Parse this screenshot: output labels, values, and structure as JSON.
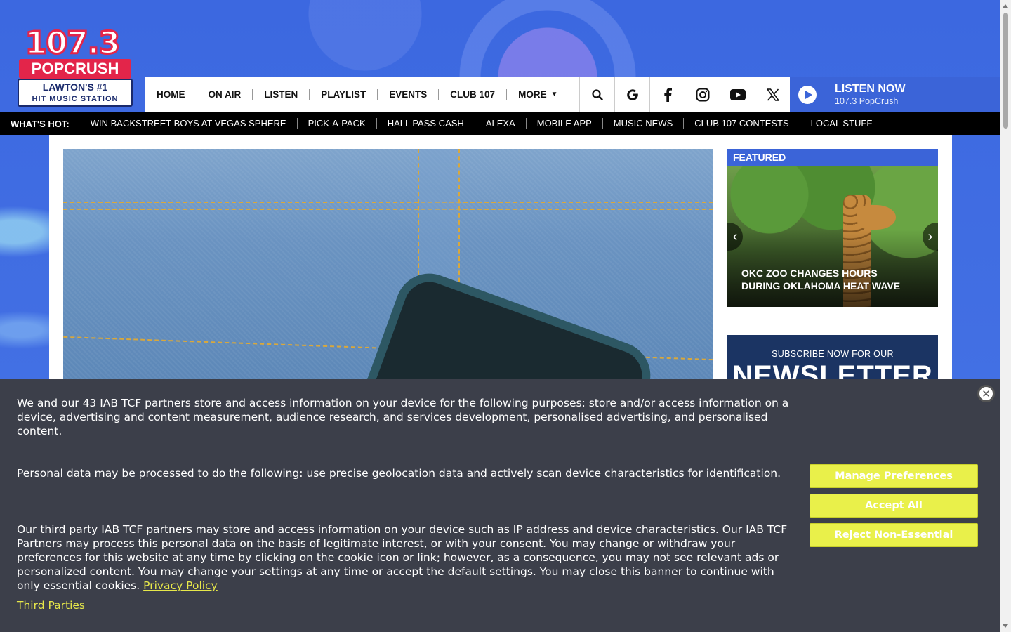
{
  "logo": {
    "number": "107.3",
    "brand": "POPCRUSH",
    "tagline": "LAWTON'S #1",
    "subtagline": "HIT MUSIC STATION"
  },
  "nav": {
    "items": [
      {
        "label": "HOME"
      },
      {
        "label": "ON AIR"
      },
      {
        "label": "LISTEN"
      },
      {
        "label": "PLAYLIST"
      },
      {
        "label": "EVENTS"
      },
      {
        "label": "CLUB 107"
      },
      {
        "label": "MORE"
      }
    ]
  },
  "icons": {
    "search": "search-icon",
    "google": "google-icon",
    "facebook": "facebook-icon",
    "instagram": "instagram-icon",
    "youtube": "youtube-icon",
    "x": "x-icon"
  },
  "listen_now": {
    "title": "LISTEN NOW",
    "station": "107.3 PopCrush"
  },
  "whats_hot": {
    "label": "WHAT'S HOT:",
    "items": [
      {
        "label": "WIN BACKSTREET BOYS AT VEGAS SPHERE"
      },
      {
        "label": "PICK-A-PACK"
      },
      {
        "label": "HALL PASS CASH"
      },
      {
        "label": "ALEXA"
      },
      {
        "label": "MOBILE APP"
      },
      {
        "label": "MUSIC NEWS"
      },
      {
        "label": "CLUB 107 CONTESTS"
      },
      {
        "label": "LOCAL STUFF"
      }
    ]
  },
  "featured": {
    "heading": "FEATURED",
    "caption": "OKC ZOO CHANGES HOURS DURING OKLAHOMA HEAT WAVE"
  },
  "newsletter": {
    "kicker": "SUBSCRIBE NOW FOR OUR",
    "title": "NEWSLETTER"
  },
  "cookie": {
    "p1": "We and our 43 IAB TCF partners store and access information on your device for the following purposes: store and/or access information on a device, advertising and content measurement, audience research, and services development, personalised advertising, and personalised content.",
    "p2": "Personal data may be processed to do the following: use precise geolocation data and actively scan device characteristics for identification.",
    "p3": "Our third party IAB TCF partners may store and access information on your device such as IP address and device characteristics. Our IAB TCF Partners may process this personal data on the basis of legitimate interest, or with your consent. You may change or withdraw your preferences for this website at any time by clicking on the cookie icon or link; however, as a consequence, you may not see relevant ads or personalized content. You may change your settings at any time or accept the default settings. You may close this banner to continue with only essential cookies.",
    "privacy_link": "Privacy Policy",
    "third_parties_link": "Third Parties",
    "manage_label": "Manage Preferences",
    "accept_label": "Accept All",
    "reject_label": "Reject Non-Essential",
    "close_glyph": "✕"
  },
  "colors": {
    "accent": "#3b64d8",
    "brand_red": "#e3254a",
    "cookie_bg": "#3c3f4a",
    "cookie_button": "#e9f04a"
  }
}
